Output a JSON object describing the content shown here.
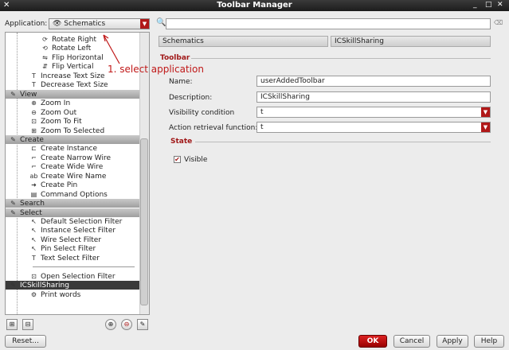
{
  "window": {
    "title": "Toolbar Manager",
    "buttons": [
      "_",
      "□",
      "✕"
    ]
  },
  "application": {
    "label": "Application:",
    "value": "Schematics"
  },
  "search": {
    "value": ""
  },
  "tree": {
    "rows": [
      {
        "label": "Rotate Right",
        "icon": "rotate-right-icon",
        "glyph": "⟳",
        "type": "item",
        "indent": 2
      },
      {
        "label": "Rotate Left",
        "icon": "rotate-left-icon",
        "glyph": "⟲",
        "type": "item",
        "indent": 2
      },
      {
        "label": "Flip Horizontal",
        "icon": "flip-horizontal-icon",
        "glyph": "⇋",
        "type": "item",
        "indent": 2
      },
      {
        "label": "Flip Vertical",
        "icon": "flip-vertical-icon",
        "glyph": "⇵",
        "type": "item",
        "indent": 2
      },
      {
        "label": "Increase Text Size",
        "icon": "increase-text-icon",
        "glyph": "T",
        "type": "item",
        "indent": 1
      },
      {
        "label": "Decrease Text Size",
        "icon": "decrease-text-icon",
        "glyph": "T",
        "type": "item",
        "indent": 1
      },
      {
        "label": "View",
        "icon": "tool-icon",
        "glyph": "✎",
        "type": "section",
        "indent": 0
      },
      {
        "label": "Zoom In",
        "icon": "zoom-in-icon",
        "glyph": "⊕",
        "type": "item",
        "indent": 1
      },
      {
        "label": "Zoom Out",
        "icon": "zoom-out-icon",
        "glyph": "⊖",
        "type": "item",
        "indent": 1
      },
      {
        "label": "Zoom To Fit",
        "icon": "zoom-fit-icon",
        "glyph": "⊡",
        "type": "item",
        "indent": 1
      },
      {
        "label": "Zoom To Selected",
        "icon": "zoom-selected-icon",
        "glyph": "⊞",
        "type": "item",
        "indent": 1
      },
      {
        "label": "Create",
        "icon": "tool-icon",
        "glyph": "✎",
        "type": "section",
        "indent": 0
      },
      {
        "label": "Create Instance",
        "icon": "instance-icon",
        "glyph": "⊏",
        "type": "item",
        "indent": 1
      },
      {
        "label": "Create Narrow Wire",
        "icon": "narrow-wire-icon",
        "glyph": "⌐",
        "type": "item",
        "indent": 1
      },
      {
        "label": "Create Wide Wire",
        "icon": "wide-wire-icon",
        "glyph": "⌐",
        "type": "item",
        "indent": 1
      },
      {
        "label": "Create Wire Name",
        "icon": "wire-name-icon",
        "glyph": "ab",
        "type": "item",
        "indent": 1
      },
      {
        "label": "Create Pin",
        "icon": "pin-icon",
        "glyph": "➜",
        "type": "item",
        "indent": 1
      },
      {
        "label": "Command Options",
        "icon": "options-icon",
        "glyph": "▤",
        "type": "item",
        "indent": 1
      },
      {
        "label": "Search",
        "icon": "tool-icon",
        "glyph": "✎",
        "type": "section",
        "indent": 0
      },
      {
        "label": "Select",
        "icon": "tool-icon",
        "glyph": "✎",
        "type": "section",
        "indent": 0
      },
      {
        "label": "Default Selection Filter",
        "icon": "filter-icon",
        "glyph": "↖",
        "type": "item",
        "indent": 1
      },
      {
        "label": "Instance Select Filter",
        "icon": "instance-filter-icon",
        "glyph": "↖",
        "type": "item",
        "indent": 1
      },
      {
        "label": "Wire Select Filter",
        "icon": "wire-filter-icon",
        "glyph": "↖",
        "type": "item",
        "indent": 1
      },
      {
        "label": "Pin Select Filter",
        "icon": "pin-filter-icon",
        "glyph": "↖",
        "type": "item",
        "indent": 1
      },
      {
        "label": "Text Select Filter",
        "icon": "text-filter-icon",
        "glyph": "T",
        "type": "item",
        "indent": 1
      },
      {
        "label": "",
        "icon": "",
        "glyph": "",
        "type": "separator",
        "indent": 1
      },
      {
        "label": "Open Selection Filter",
        "icon": "open-filter-icon",
        "glyph": "⊡",
        "type": "item",
        "indent": 1
      },
      {
        "label": "ICSkillSharing",
        "icon": "tool-icon",
        "glyph": "✎",
        "type": "selected",
        "indent": 0
      },
      {
        "label": "Print words",
        "icon": "print-words-icon",
        "glyph": "⚙",
        "type": "item",
        "indent": 1
      }
    ]
  },
  "detail": {
    "app_header": "Schematics",
    "toolbar_header": "ICSkillSharing",
    "toolbar_group": "Toolbar",
    "name_label": "Name:",
    "name_value": "userAddedToolbar",
    "description_label": "Description:",
    "description_value": "ICSkillSharing",
    "visibility_label": "Visibility condition",
    "visibility_value": "t",
    "action_label": "Action retrieval function:",
    "action_value": "t",
    "state_group": "State",
    "visible_label": "Visible",
    "visible_checked": true
  },
  "annotation": {
    "text": "1. select application"
  },
  "footer": {
    "reset": "Reset...",
    "ok": "OK",
    "cancel": "Cancel",
    "apply": "Apply",
    "help": "Help"
  }
}
